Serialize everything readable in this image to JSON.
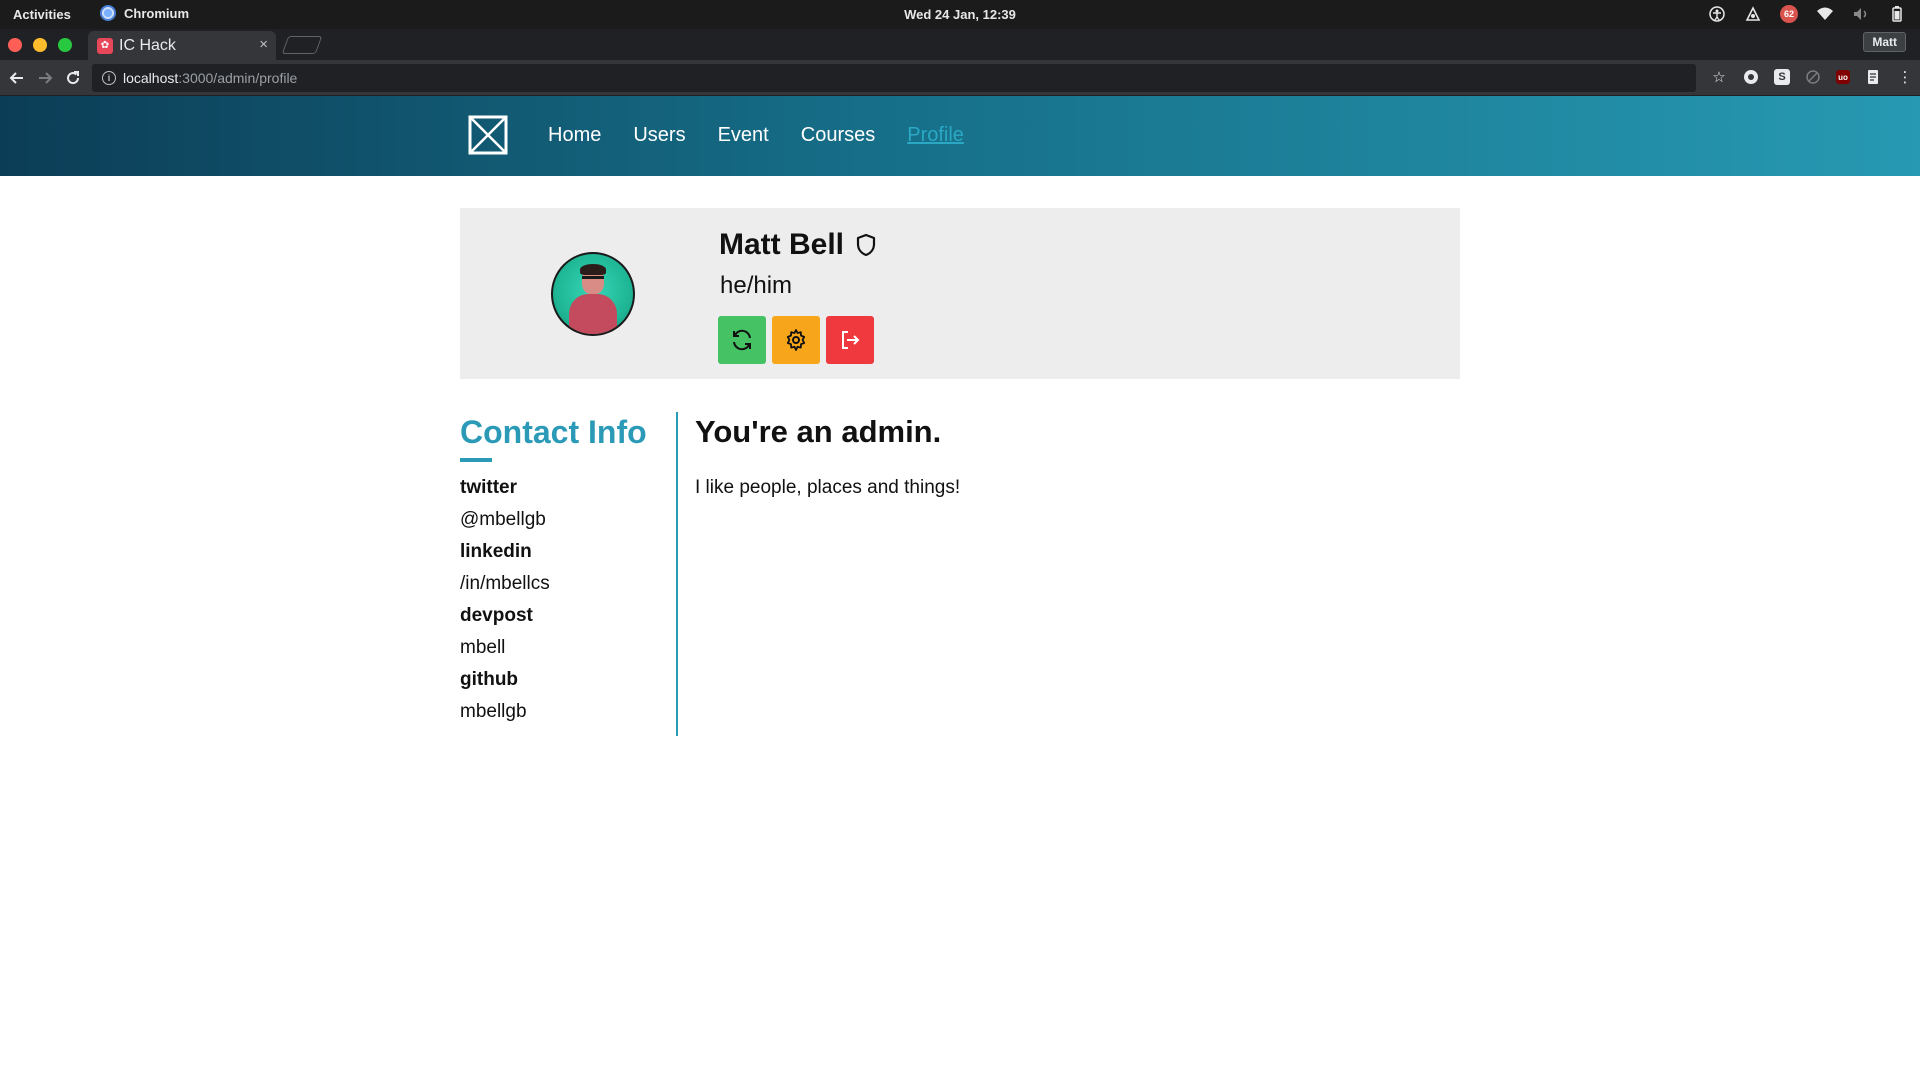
{
  "os_bar": {
    "activities": "Activities",
    "app_name": "Chromium",
    "clock": "Wed 24 Jan, 12:39",
    "notification_count": "62"
  },
  "browser": {
    "tab_title": "IC Hack",
    "tab_close": "×",
    "profile_name": "Matt",
    "url_host": "localhost",
    "url_path": ":3000/admin/profile"
  },
  "site": {
    "nav": [
      {
        "label": "Home",
        "active": false
      },
      {
        "label": "Users",
        "active": false
      },
      {
        "label": "Event",
        "active": false
      },
      {
        "label": "Courses",
        "active": false
      },
      {
        "label": "Profile",
        "active": true
      }
    ],
    "accent_color": "#2a9ab7"
  },
  "profile": {
    "name": "Matt Bell",
    "pronouns": "he/him",
    "admin_badge_icon": "shield-icon",
    "actions": [
      {
        "icon": "refresh-icon",
        "color": "#45c264"
      },
      {
        "icon": "gear-icon",
        "color": "#f7a51b"
      },
      {
        "icon": "logout-icon",
        "color": "#f0383f"
      }
    ]
  },
  "contact": {
    "title": "Contact Info",
    "items": [
      {
        "label": "twitter",
        "value": "@mbellgb"
      },
      {
        "label": "linkedin",
        "value": "/in/mbellcs"
      },
      {
        "label": "devpost",
        "value": "mbell"
      },
      {
        "label": "github",
        "value": "mbellgb"
      }
    ]
  },
  "main": {
    "heading": "You're an admin.",
    "bio": "I like people, places and things!"
  }
}
